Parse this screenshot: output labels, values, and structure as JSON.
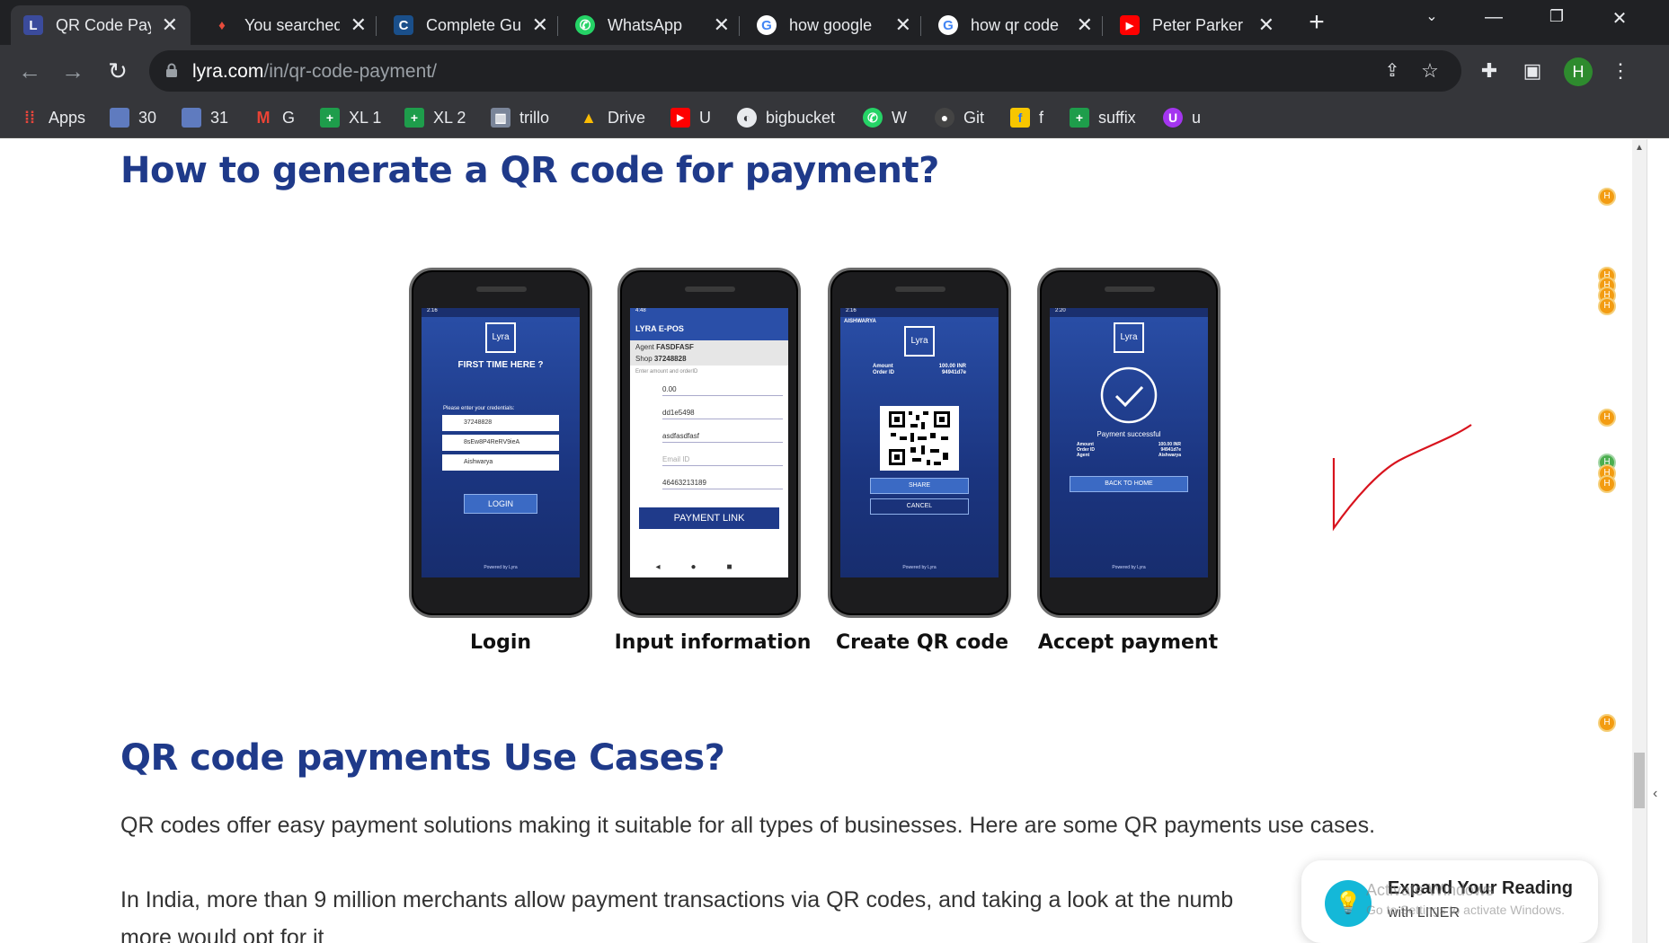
{
  "tabs": [
    {
      "title": "QR Code Pay",
      "favicon": "L",
      "fav_bg": "#3b4b9c",
      "fav_fg": "#fff",
      "active": true
    },
    {
      "title": "You searched",
      "favicon": "♦",
      "fav_bg": "transparent",
      "fav_fg": "#e74c3c",
      "active": false
    },
    {
      "title": "Complete Gu",
      "favicon": "C",
      "fav_bg": "#1a4f8a",
      "fav_fg": "#fff",
      "active": false
    },
    {
      "title": "WhatsApp",
      "favicon": "✆",
      "fav_bg": "#25d366",
      "fav_fg": "#fff",
      "active": false
    },
    {
      "title": "how google",
      "favicon": "G",
      "fav_bg": "#fff",
      "fav_fg": "#4285f4",
      "active": false
    },
    {
      "title": "how qr code",
      "favicon": "G",
      "fav_bg": "#fff",
      "fav_fg": "#4285f4",
      "active": false
    },
    {
      "title": "Peter Parker",
      "favicon": "▶",
      "fav_bg": "#ff0000",
      "fav_fg": "#fff",
      "active": false
    }
  ],
  "omnibox": {
    "host": "lyra.com",
    "path": "/in/qr-code-payment/"
  },
  "profile_initial": "H",
  "bookmarks": [
    {
      "label": "Apps",
      "icon": "apps-grid-icon",
      "color": "#e8453c"
    },
    {
      "label": "30",
      "icon": "site-icon",
      "color": "#5f7bbf"
    },
    {
      "label": "31",
      "icon": "site-icon",
      "color": "#5f7bbf"
    },
    {
      "label": "G",
      "icon": "gmail-icon",
      "color": "#ea4335"
    },
    {
      "label": "XL 1",
      "icon": "sheets-icon",
      "color": "#1e9d4b"
    },
    {
      "label": "XL 2",
      "icon": "sheets-icon",
      "color": "#1e9d4b"
    },
    {
      "label": "trillo",
      "icon": "trello-icon",
      "color": "#7a8599"
    },
    {
      "label": "Drive",
      "icon": "drive-icon",
      "color": "#fbbc04"
    },
    {
      "label": "U",
      "icon": "youtube-icon",
      "color": "#ff0000"
    },
    {
      "label": "bigbucket",
      "icon": "globe-icon",
      "color": "#9aa0a6"
    },
    {
      "label": "W",
      "icon": "whatsapp-icon",
      "color": "#25d366"
    },
    {
      "label": "Git",
      "icon": "github-icon",
      "color": "#444"
    },
    {
      "label": "f",
      "icon": "flipkart-icon",
      "color": "#f7c600"
    },
    {
      "label": "suffix",
      "icon": "sheets-icon",
      "color": "#1e9d4b"
    },
    {
      "label": "u",
      "icon": "udemy-icon",
      "color": "#a435f0"
    }
  ],
  "content": {
    "heading1": "How to generate a QR code for payment?",
    "heading2": "QR code payments Use Cases?",
    "para1": "QR codes offer easy payment solutions making it suitable for all types of businesses. Here are some QR payments use cases.",
    "para2": "In India, more than 9 million merchants allow payment transactions via QR codes, and taking a look at the numb",
    "para3": "more would opt for it"
  },
  "phones": [
    {
      "caption": "Login",
      "status": "2:16",
      "logo": "Lyra",
      "title": "FIRST TIME HERE ?",
      "hint": "Please enter your credentials:",
      "fields": [
        "37248828",
        "8sEw8P4ReRV9ieA",
        "Aishwarya"
      ],
      "button": "LOGIN",
      "powered": "Powered by Lyra"
    },
    {
      "caption": "Input information",
      "status": "4:48",
      "app_title": "LYRA E-POS",
      "agent_label": "Agent",
      "agent": "FASDFASF",
      "shop_label": "Shop",
      "shop": "37248828",
      "hint": "Enter amount and orderID",
      "fields": [
        "0.00",
        "dd1e5498",
        "asdfasdfasf",
        "Email ID",
        "46463213189"
      ],
      "button": "PAYMENT LINK"
    },
    {
      "caption": "Create QR code",
      "status": "2:16",
      "user": "AISHWARYA",
      "logo": "Lyra",
      "amount_label": "Amount",
      "amount": "100.00 INR",
      "order_label": "Order ID",
      "order": "94941d7e",
      "button1": "SHARE",
      "button2": "CANCEL",
      "powered": "Powered by Lyra"
    },
    {
      "caption": "Accept payment",
      "status": "2:20",
      "logo": "Lyra",
      "success": "Payment successful",
      "amount_label": "Amount",
      "amount": "100.00 INR",
      "order_label": "Order ID",
      "order": "94941d7e",
      "agent_label": "Agent",
      "agent": "Aishwarya",
      "button": "BACK TO HOME",
      "powered": "Powered by Lyra"
    }
  ],
  "liner": {
    "title": "Expand Your Reading",
    "subtitle": "with LINER"
  },
  "watermark": {
    "line1": "Activate Windows",
    "line2": "Go to Settings to activate Windows."
  },
  "highlight_marker": "H"
}
